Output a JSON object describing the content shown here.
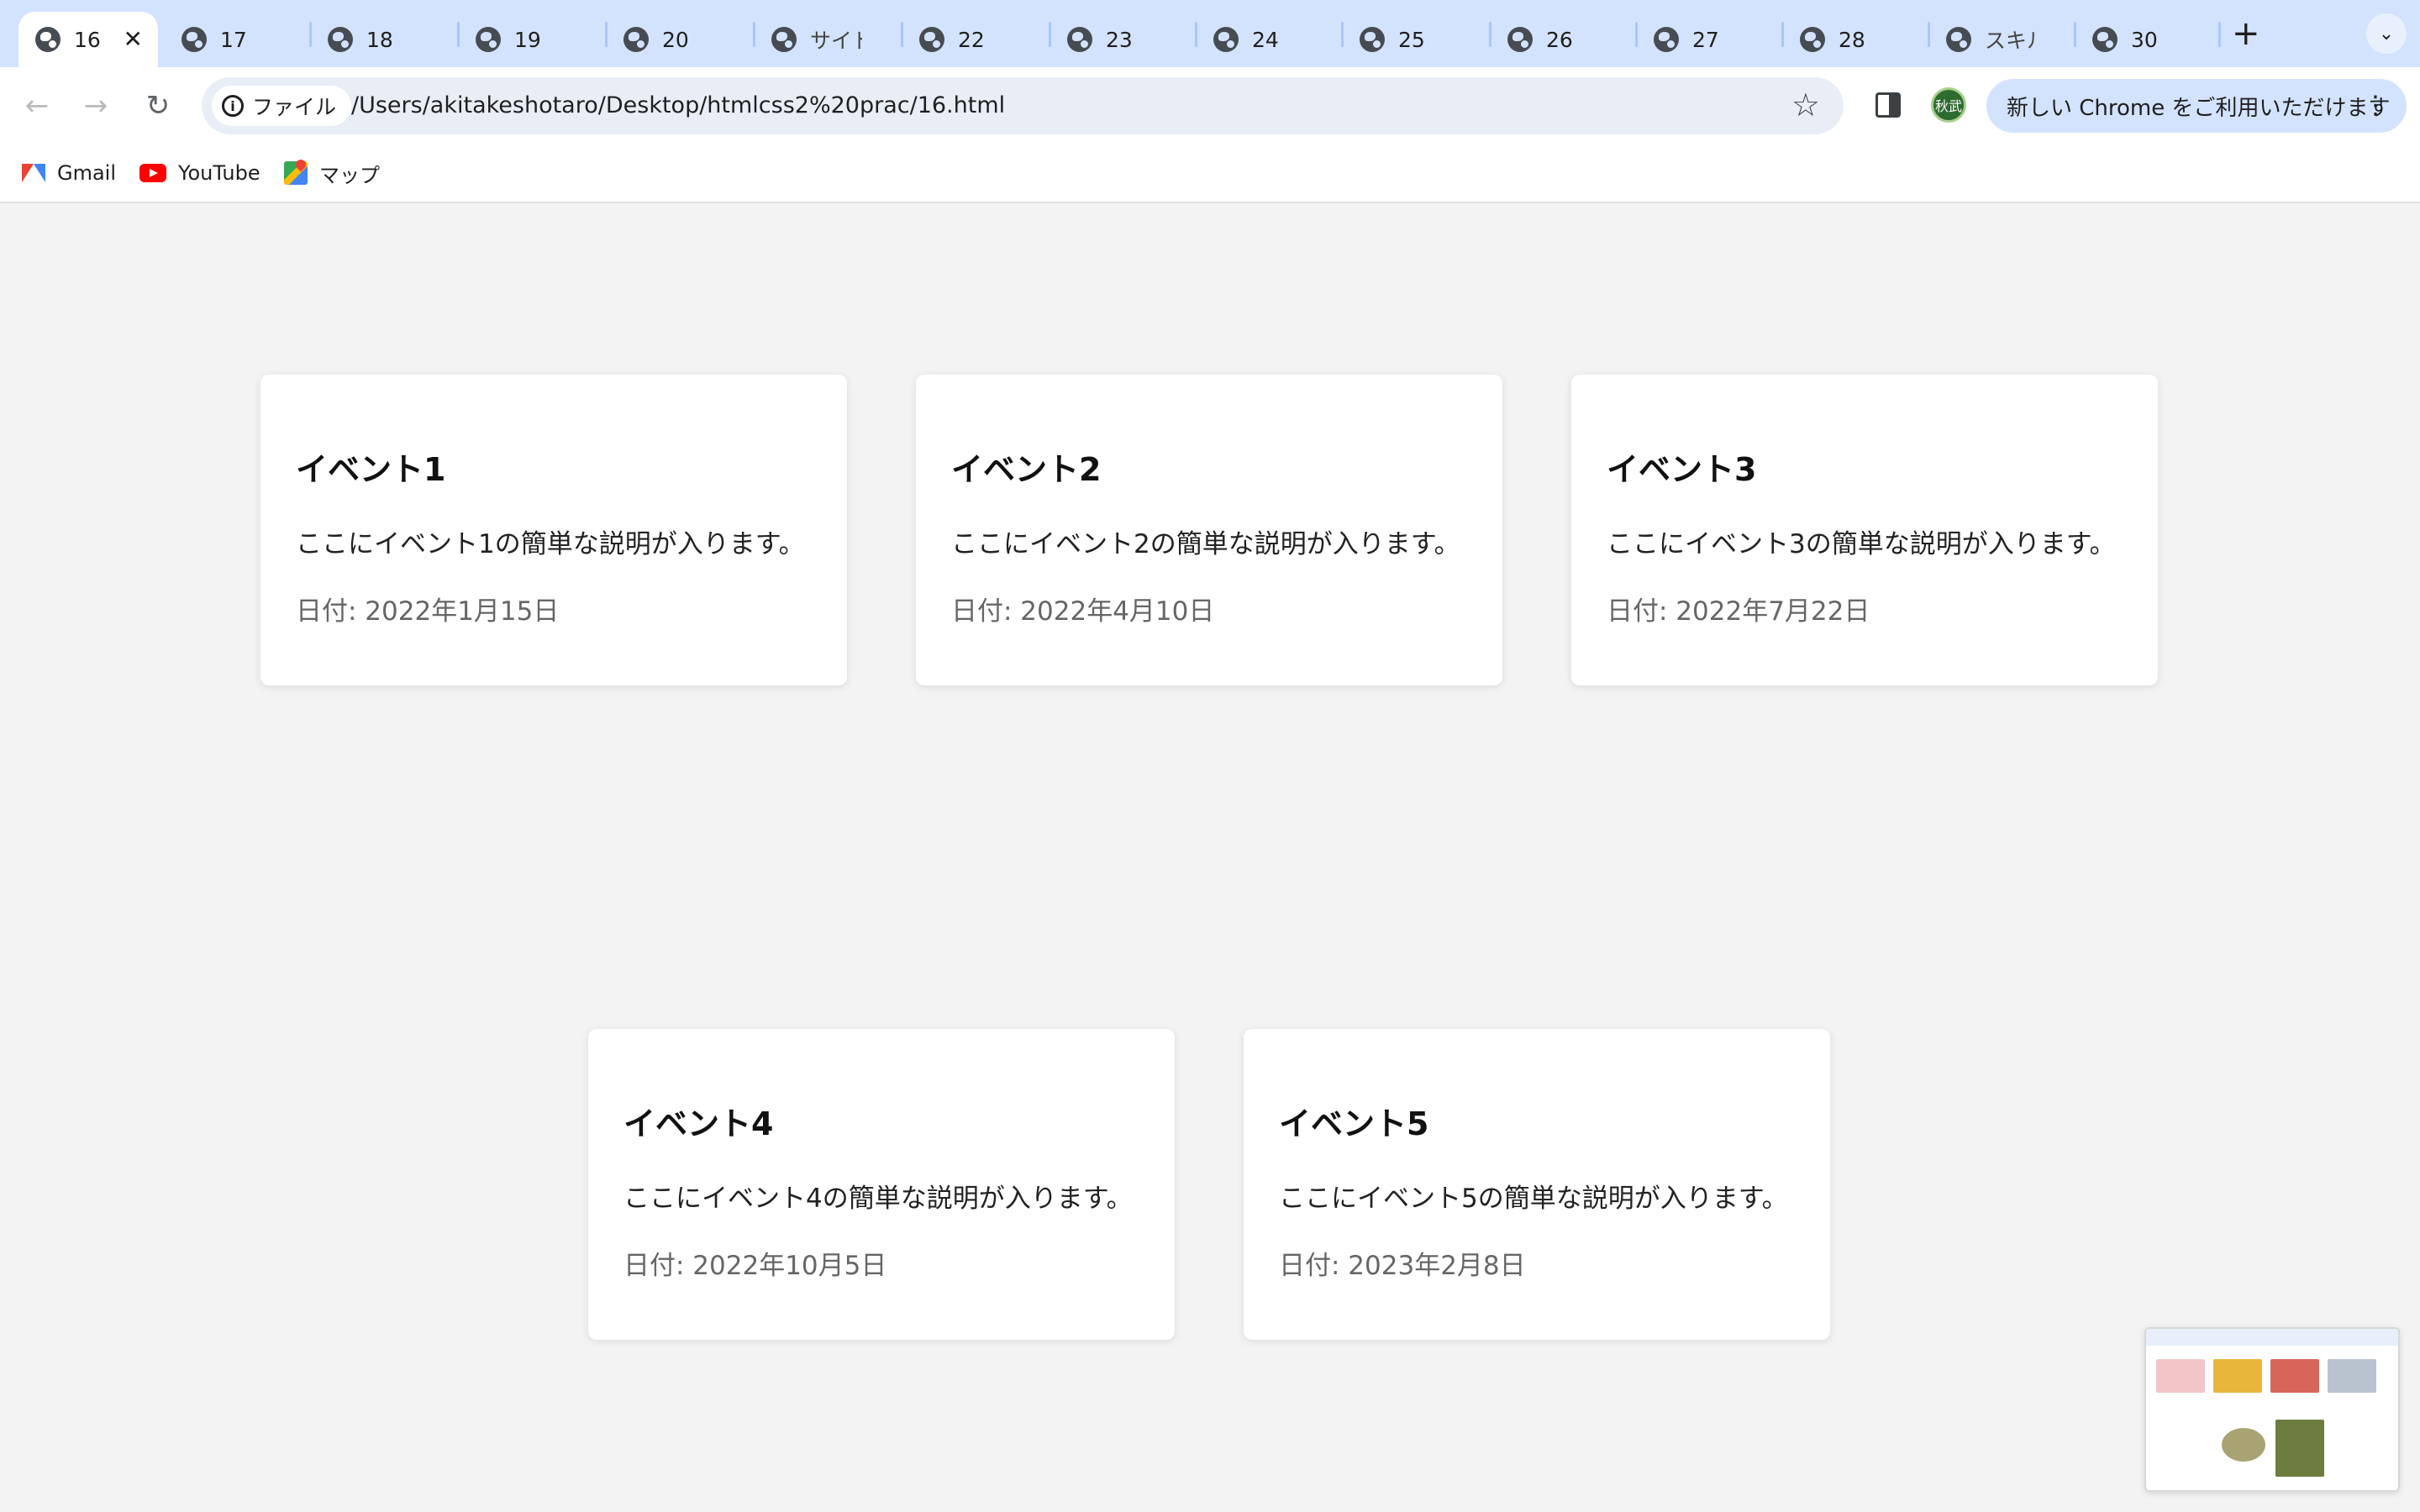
{
  "browser": {
    "tabs": [
      {
        "label": "16",
        "active": true
      },
      {
        "label": "17"
      },
      {
        "label": "18"
      },
      {
        "label": "19"
      },
      {
        "label": "20"
      },
      {
        "label": "サイドナ"
      },
      {
        "label": "22"
      },
      {
        "label": "23"
      },
      {
        "label": "24"
      },
      {
        "label": "25"
      },
      {
        "label": "26"
      },
      {
        "label": "27"
      },
      {
        "label": "28"
      },
      {
        "label": "スキルア"
      },
      {
        "label": "30"
      }
    ],
    "close_glyph": "✕",
    "new_tab_glyph": "+",
    "tab_search_glyph": "⌄",
    "omnibox": {
      "chip_label": "ファイル",
      "url": "/Users/akitakeshotaro/Desktop/htmlcss2%20prac/16.html"
    },
    "profile_initials": "秋武",
    "update_button": "新しい Chrome をご利用いただけます",
    "menu_glyph": "⋮",
    "nav": {
      "back": "←",
      "forward": "→",
      "reload": "↻",
      "star": "☆"
    },
    "bookmarks": [
      {
        "label": "Gmail",
        "icon": "gmail-icon"
      },
      {
        "label": "YouTube",
        "icon": "youtube-icon"
      },
      {
        "label": "マップ",
        "icon": "maps-icon"
      }
    ]
  },
  "events": [
    {
      "title": "イベント1",
      "description": "ここにイベント1の簡単な説明が入ります。",
      "date": "日付: 2022年1月15日"
    },
    {
      "title": "イベント2",
      "description": "ここにイベント2の簡単な説明が入ります。",
      "date": "日付: 2022年4月10日"
    },
    {
      "title": "イベント3",
      "description": "ここにイベント3の簡単な説明が入ります。",
      "date": "日付: 2022年7月22日"
    },
    {
      "title": "イベント4",
      "description": "ここにイベント4の簡単な説明が入ります。",
      "date": "日付: 2022年10月5日"
    },
    {
      "title": "イベント5",
      "description": "ここにイベント5の簡単な説明が入ります。",
      "date": "日付: 2023年2月8日"
    }
  ],
  "colors": {
    "page_background": "#f3f3f3",
    "card_background": "#ffffff",
    "tabstrip": "#d3e3fd",
    "date_text": "#666666"
  }
}
